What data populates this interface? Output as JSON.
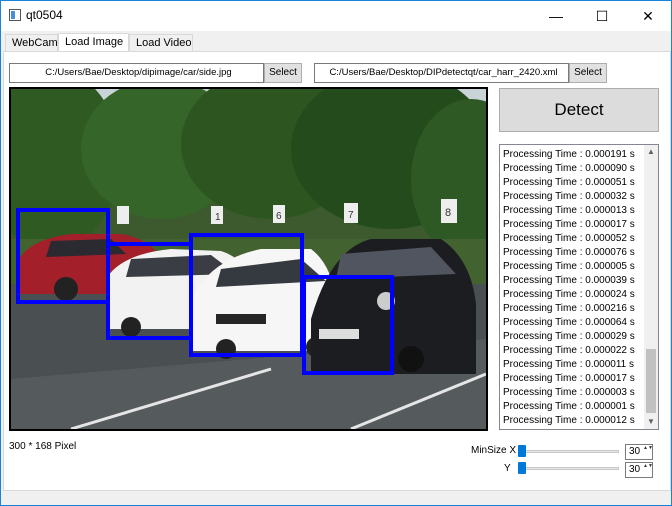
{
  "window": {
    "title": "qt0504"
  },
  "titlebar_buttons": {
    "minimize": "—",
    "maximize": "☐",
    "close": "✕"
  },
  "tabs": [
    {
      "label": "WebCam",
      "active": false
    },
    {
      "label": "Load Image",
      "active": true
    },
    {
      "label": "Load Video",
      "active": false
    }
  ],
  "image_path": {
    "value": "C:/Users/Bae/Desktop/dipimage/car/side.jpg",
    "button": "Select"
  },
  "xml_path": {
    "value": "C:/Users/Bae/Desktop/DIPdetectqt/car_harr_2420.xml",
    "button": "Select"
  },
  "detect_button": "Detect",
  "processing_log": [
    "Processing Time : 0.000191 s",
    "Processing Time : 0.000090 s",
    "Processing Time : 0.000051 s",
    "Processing Time : 0.000032 s",
    "Processing Time : 0.000013 s",
    "Processing Time : 0.000017 s",
    "Processing Time : 0.000052 s",
    "Processing Time : 0.000076 s",
    "Processing Time : 0.000005 s",
    "Processing Time : 0.000039 s",
    "Processing Time : 0.000024 s",
    "Processing Time : 0.000216 s",
    "Processing Time : 0.000064 s",
    "Processing Time : 0.000029 s",
    "Processing Time : 0.000022 s",
    "Processing Time : 0.000011 s",
    "Processing Time : 0.000017 s",
    "Processing Time : 0.000003 s",
    "Processing Time : 0.000001 s",
    "Processing Time : 0.000012 s"
  ],
  "scroll_arrows": {
    "up": "▲",
    "down": "▼"
  },
  "pixel_info": "300 * 168 Pixel",
  "min_size": {
    "x_label": "MinSize X",
    "y_label": "Y",
    "x_value": "30",
    "y_value": "30"
  },
  "spin_arrows": "▲▼",
  "parking_signs": [
    "1",
    "6",
    "7",
    "8"
  ],
  "colors": {
    "detection_box": "#0000ff",
    "accent": "#0078d7"
  },
  "icons": {
    "app": "window-icon"
  }
}
